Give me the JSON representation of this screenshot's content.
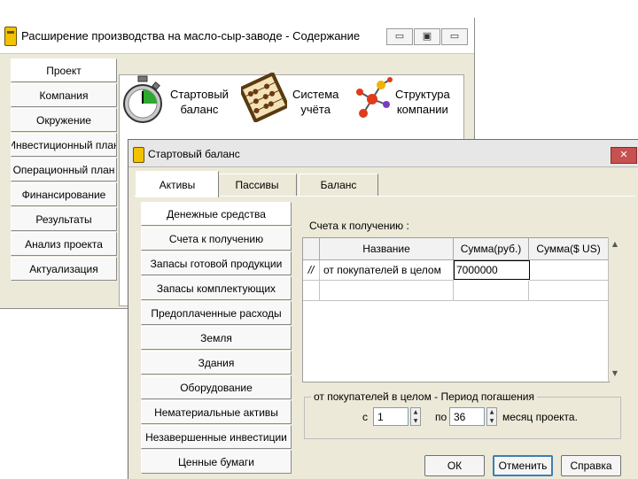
{
  "main_window": {
    "title": "Расширение производства на масло-сыр-заводе - Содержание",
    "title_buttons": [
      "▭",
      "▣",
      "▭"
    ],
    "nav_items": [
      {
        "label": "Проект"
      },
      {
        "label": "Компания"
      },
      {
        "label": "Окружение"
      },
      {
        "label": "Инвестиционный план"
      },
      {
        "label": "Операционный план"
      },
      {
        "label": "Финансирование"
      },
      {
        "label": "Результаты"
      },
      {
        "label": "Анализ проекта"
      },
      {
        "label": "Актуализация"
      }
    ],
    "icons": [
      {
        "icon": "stopwatch-icon",
        "line1": "Стартовый",
        "line2": "баланс"
      },
      {
        "icon": "abacus-icon",
        "line1": "Система",
        "line2": "учёта"
      },
      {
        "icon": "molecule-icon",
        "line1": "Структура",
        "line2": "компании"
      }
    ]
  },
  "dialog": {
    "title": "Стартовый баланс",
    "close_label": "✕",
    "tabs": [
      {
        "label": "Активы"
      },
      {
        "label": "Пассивы"
      },
      {
        "label": "Баланс"
      }
    ],
    "asset_items": [
      {
        "label": "Денежные средства"
      },
      {
        "label": "Счета к получению"
      },
      {
        "label": "Запасы готовой продукции"
      },
      {
        "label": "Запасы комплектующих"
      },
      {
        "label": "Предоплаченные расходы"
      },
      {
        "label": "Земля"
      },
      {
        "label": "Здания"
      },
      {
        "label": "Оборудование"
      },
      {
        "label": "Нематериальные активы"
      },
      {
        "label": "Незавершенные инвестиции"
      },
      {
        "label": "Ценные бумаги"
      }
    ],
    "section_label": "Счета к получению :",
    "table": {
      "columns": [
        "Название",
        "Сумма(руб.)",
        "Сумма($ US)"
      ],
      "rows": [
        {
          "marker": "//",
          "name": "от покупателей в целом",
          "sum_rub": "7000000",
          "sum_usd": ""
        }
      ]
    },
    "repayment": {
      "title": "от покупателей в целом - Период погашения",
      "from_label": "с",
      "from_value": "1",
      "to_label": "по",
      "to_value": "36",
      "unit": "месяц проекта."
    },
    "buttons": {
      "ok": "ОК",
      "cancel": "Отменить",
      "help": "Справка"
    }
  }
}
